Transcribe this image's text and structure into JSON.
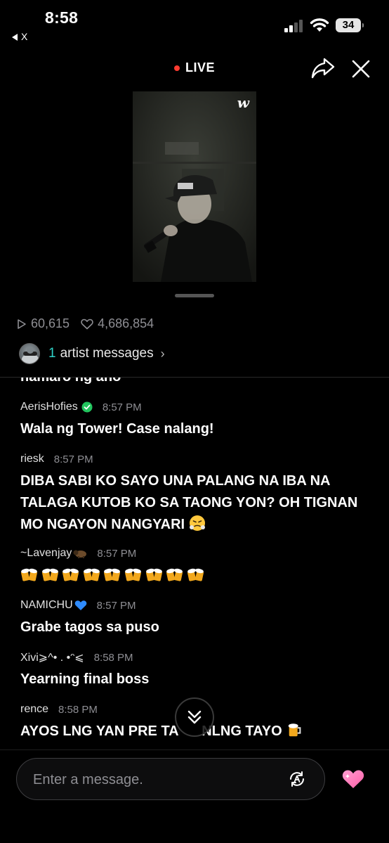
{
  "status_bar": {
    "time": "8:58",
    "back_app": "X",
    "battery": "34"
  },
  "header": {
    "live_label": "LIVE",
    "video_logo": "w"
  },
  "stats": {
    "plays": "60,615",
    "likes": "4,686,854"
  },
  "artist_messages": {
    "count": "1",
    "label": "artist messages"
  },
  "chat": {
    "cut_off_message": "namaro ng ano",
    "messages": [
      {
        "user": "AerisHofies",
        "badge": "verified-icon",
        "time": "8:57 PM",
        "text": "Wala ng Tower! Case nalang!"
      },
      {
        "user": "riesk",
        "time": "8:57 PM",
        "text": "DIBA SABI KO SAYO UNA PALANG NA IBA NA TALAGA KUTOB KO SA TAONG YON? OH TIGNAN MO NGAYON NANGYARI",
        "emoji": "face-with-steam-icon"
      },
      {
        "user": "~Lavenjay",
        "badge": "bison-icon",
        "time": "8:57 PM",
        "text": "",
        "beers": 9
      },
      {
        "user": "NAMICHU",
        "badge": "blue-heart-icon",
        "time": "8:57 PM",
        "text": "Grabe tagos sa puso"
      },
      {
        "user": "Xivi⩾^• . •ᵔ⩽",
        "time": "8:58 PM",
        "text": "Yearning final boss"
      },
      {
        "user": "rence",
        "time": "8:58 PM",
        "text": "AYOS LNG YAN PRE TA      NLNG TAYO",
        "emoji": "beer-mug-icon"
      }
    ]
  },
  "input": {
    "placeholder": "Enter a message."
  },
  "colors": {
    "background": "#000000",
    "accent_teal": "#2fd3c8",
    "live_red": "#ff3b30",
    "heart_pink": "#ff6fae",
    "muted": "#8e8e93"
  }
}
